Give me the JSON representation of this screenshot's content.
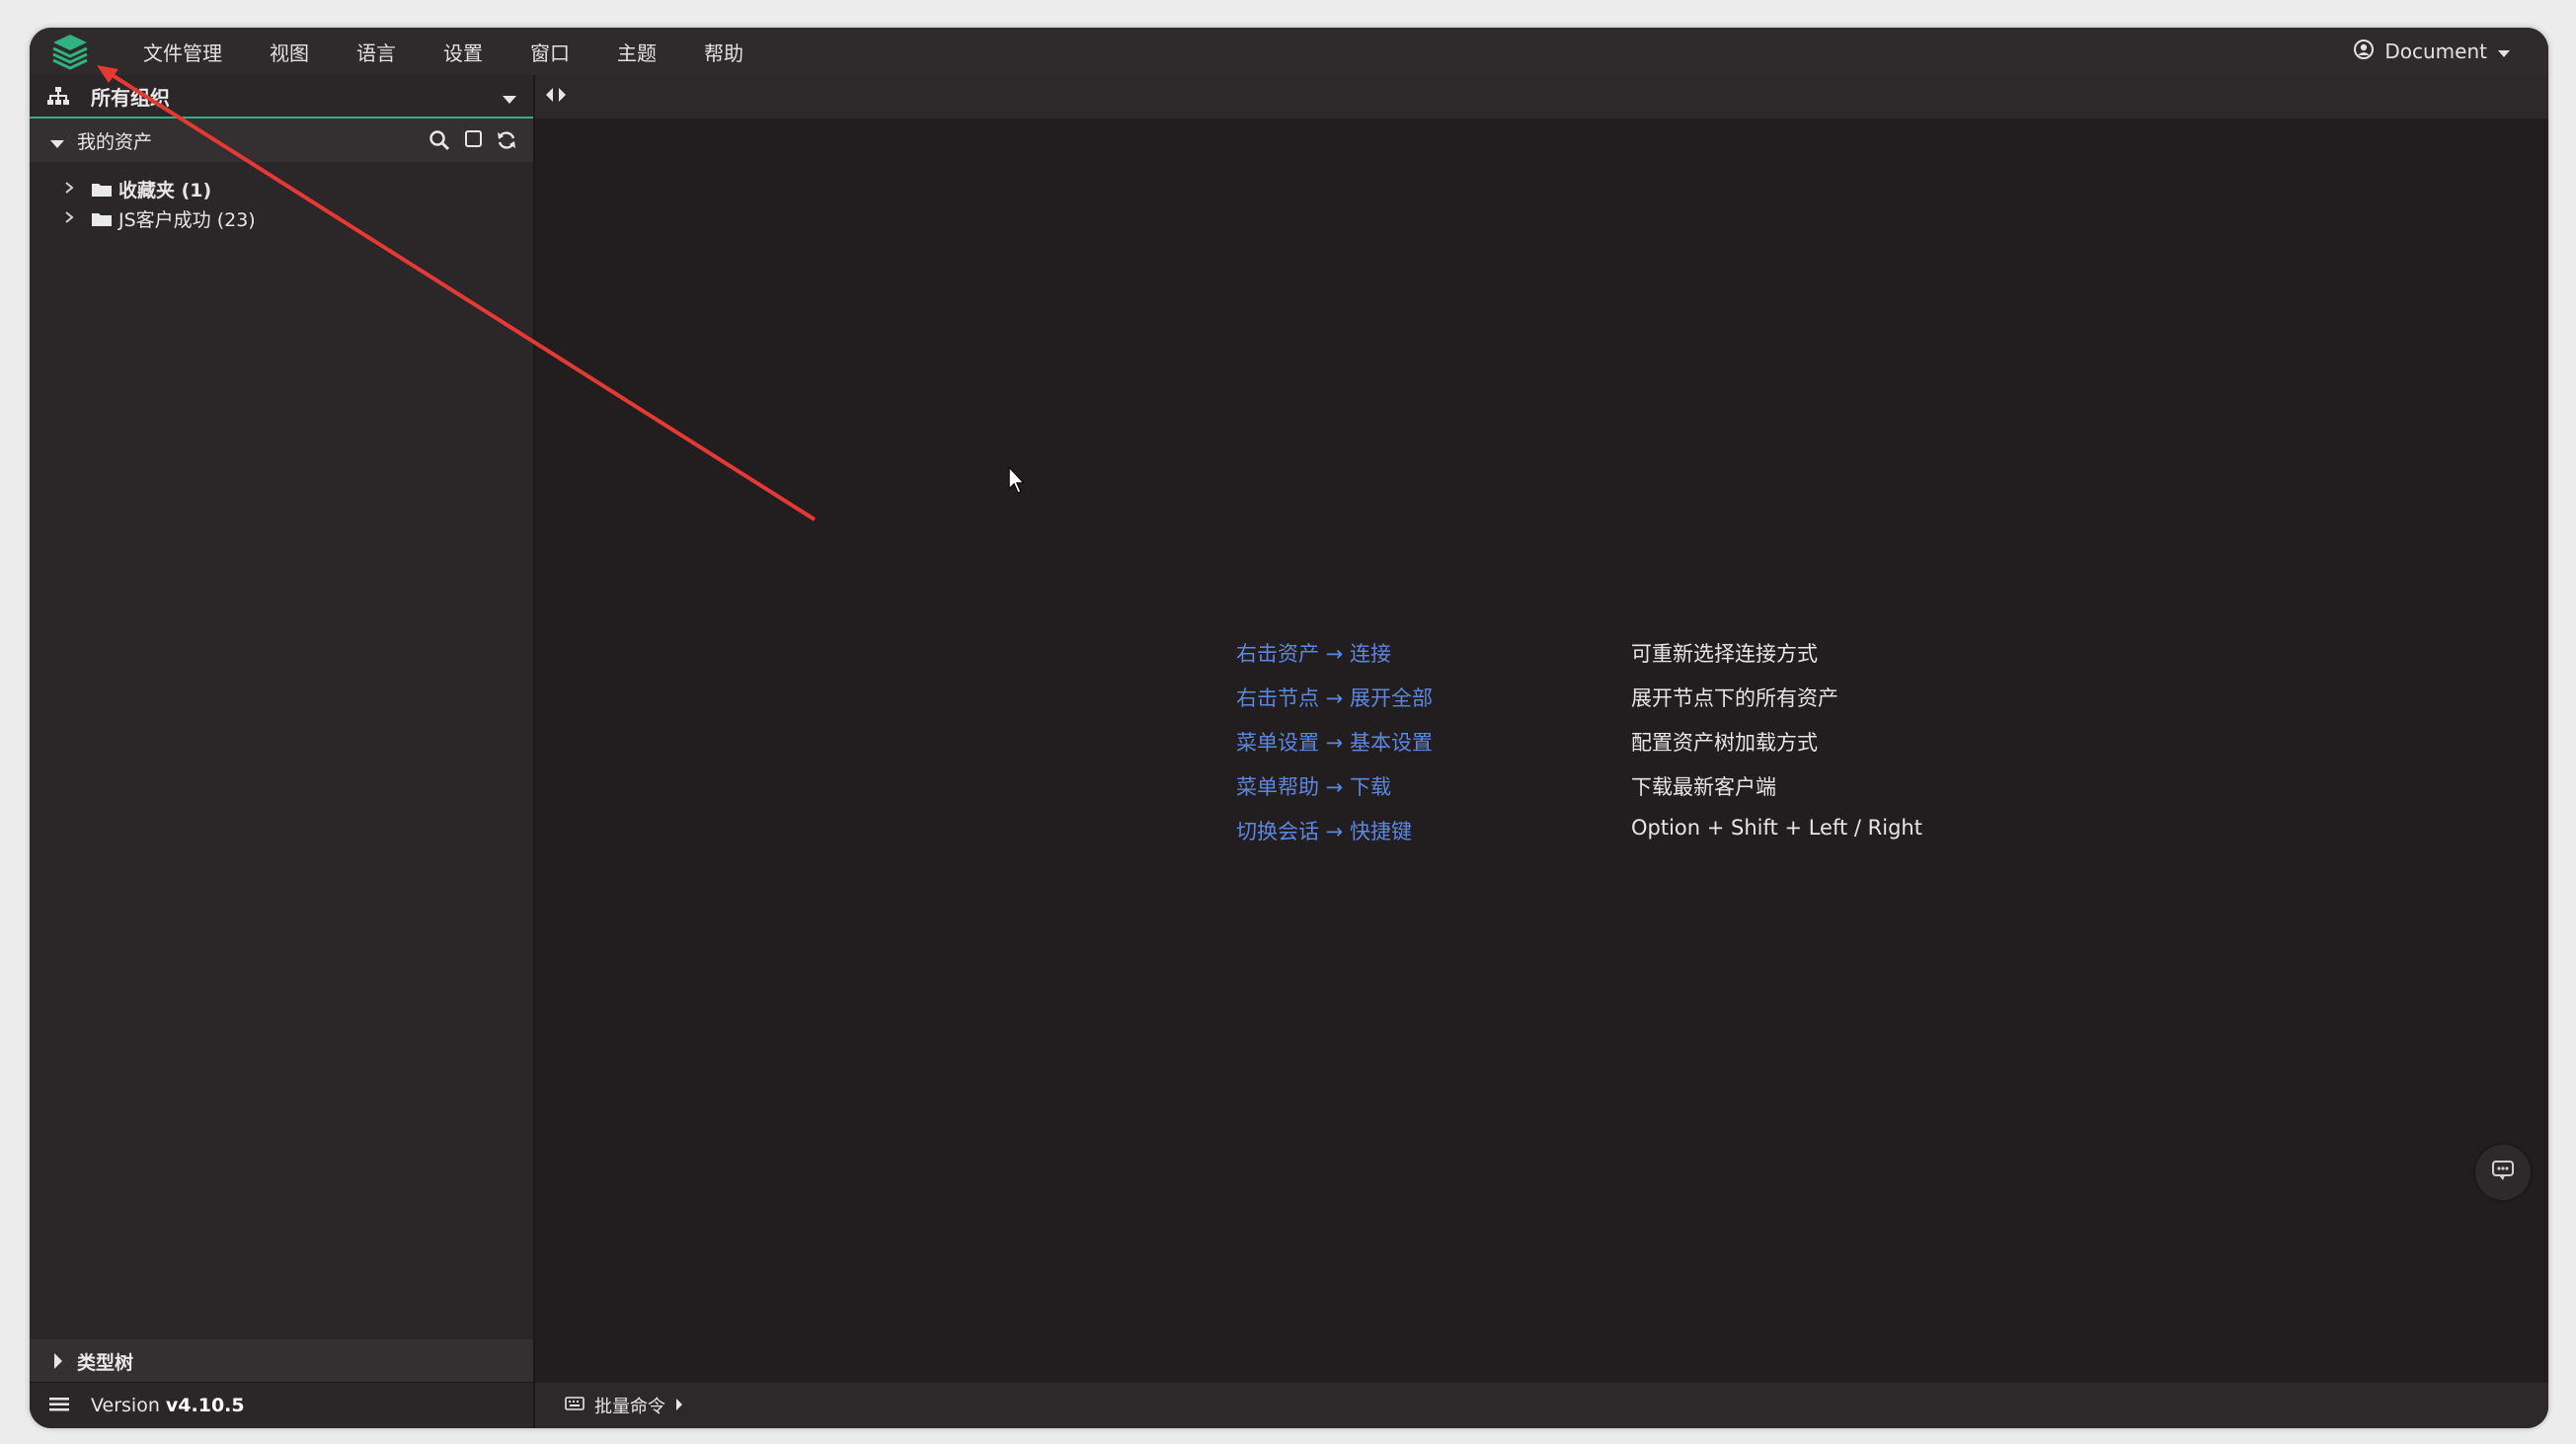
{
  "menu": {
    "items": [
      "文件管理",
      "视图",
      "语言",
      "设置",
      "窗口",
      "主题",
      "帮助"
    ]
  },
  "account": {
    "label": "Document"
  },
  "sidebar": {
    "org_label": "所有组织",
    "assets_title": "我的资产",
    "tree": [
      {
        "label": "收藏夹 (1)"
      },
      {
        "label": "JS客户成功 (23)"
      }
    ],
    "type_tree_label": "类型树",
    "version_prefix": "Version ",
    "version_value": "v4.10.5"
  },
  "main": {
    "tips": [
      {
        "key": "右击资产 → 连接",
        "desc": "可重新选择连接方式"
      },
      {
        "key": "右击节点 → 展开全部",
        "desc": "展开节点下的所有资产"
      },
      {
        "key": "菜单设置 → 基本设置",
        "desc": "配置资产树加载方式"
      },
      {
        "key": "菜单帮助 → 下载",
        "desc": "下载最新客户端"
      },
      {
        "key": "切换会话 → 快捷键",
        "desc": "Option + Shift + Left / Right"
      }
    ],
    "batch_label": "批量命令"
  },
  "colors": {
    "accent": "#2fb383",
    "link": "#5c87e0",
    "annotation": "#e53935",
    "background": "#211d1e"
  }
}
